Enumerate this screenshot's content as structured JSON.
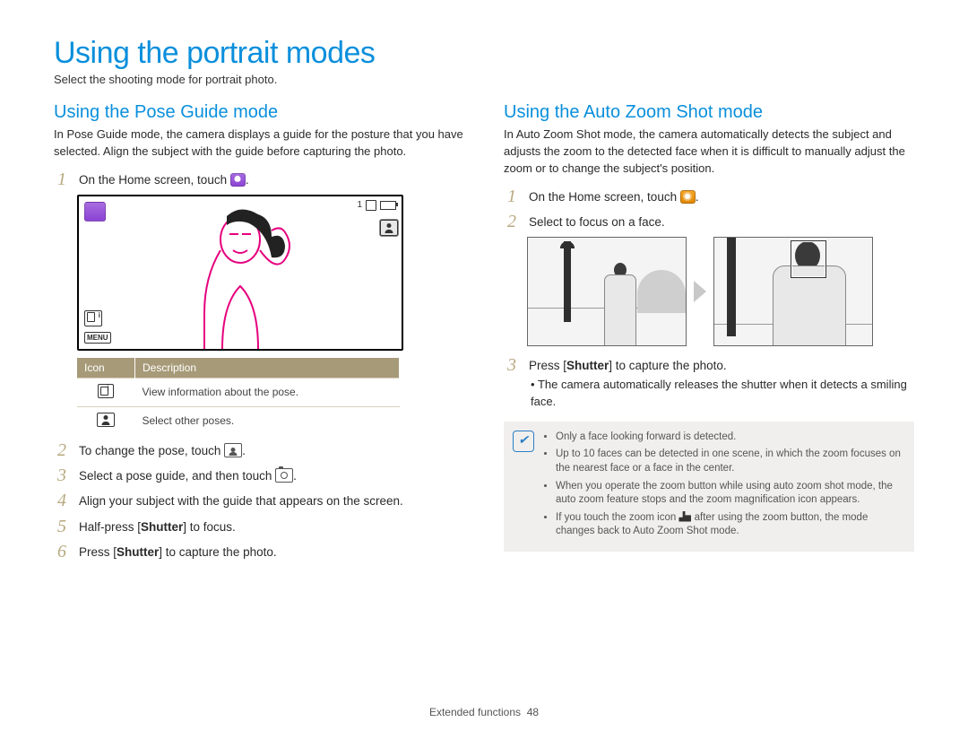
{
  "page": {
    "title": "Using the portrait modes",
    "subtitle": "Select the shooting mode for portrait photo.",
    "footer_label": "Extended functions",
    "footer_page": "48"
  },
  "left": {
    "heading": "Using the Pose Guide mode",
    "intro": "In Pose Guide mode, the camera displays a guide for the posture that you have selected. Align the subject with the guide before capturing the photo.",
    "steps": {
      "s1_pre": "On the Home screen, touch ",
      "s1_icon": "pose-guide-mode-icon",
      "s1_post": ".",
      "s2_pre": "To change the pose, touch ",
      "s2_icon": "pose-select-icon",
      "s2_post": ".",
      "s3_pre": "Select a pose guide, and then touch ",
      "s3_icon": "camera-capture-icon",
      "s3_post": ".",
      "s4": "Align your subject with the guide that appears on the screen.",
      "s5_pre": "Half-press [",
      "s5_bold": "Shutter",
      "s5_post": "] to focus.",
      "s6_pre": "Press [",
      "s6_bold": "Shutter",
      "s6_post": "] to capture the photo."
    },
    "screenshot": {
      "status_count": "1",
      "menu_label": "MENU"
    },
    "table": {
      "head_icon": "Icon",
      "head_desc": "Description",
      "row1_desc": "View information about the pose.",
      "row2_desc": "Select other poses."
    }
  },
  "right": {
    "heading": "Using the Auto Zoom Shot mode",
    "intro": "In Auto Zoom Shot mode, the camera automatically detects the subject and adjusts the zoom to the detected face when it is difficult to manually adjust the zoom or to change the subject's position.",
    "steps": {
      "s1_pre": "On the Home screen, touch ",
      "s1_icon": "auto-zoom-shot-mode-icon",
      "s1_post": ".",
      "s2": "Select to focus on a face.",
      "s3_pre": "Press [",
      "s3_bold": "Shutter",
      "s3_post": "] to capture the photo.",
      "s3_sub": "The camera automatically releases the shutter when it detects a smiling face."
    },
    "note_items": [
      "Only a face looking forward is detected.",
      "Up to 10 faces can be detected in one scene, in which the zoom focuses on the nearest face or a face in the center.",
      "When you operate the zoom button while using auto zoom shot mode, the auto zoom feature stops and the zoom magnification icon appears.",
      "If you touch the zoom icon __ZOOM_ICON__ after using the zoom button, the mode changes back to Auto Zoom Shot mode."
    ]
  }
}
